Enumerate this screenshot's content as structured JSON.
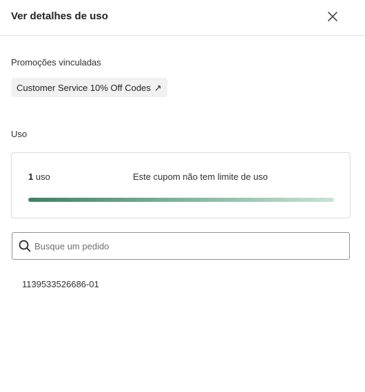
{
  "header": {
    "title": "Ver detalhes de uso",
    "close_icon": "close-icon"
  },
  "promotions": {
    "label": "Promoções vinculadas",
    "items": [
      {
        "label": "Customer Service 10% Off Codes",
        "icon": "arrow-up-right-icon"
      }
    ]
  },
  "usage": {
    "label": "Uso",
    "count_number": "1",
    "count_unit": "uso",
    "limit_text": "Este cupom não tem limite de uso",
    "progress": 1.0,
    "colors": {
      "start": "#3f8263",
      "end": "#c8e2d6"
    }
  },
  "search": {
    "placeholder": "Busque um pedido",
    "value": "",
    "icon": "search-icon"
  },
  "orders": [
    {
      "id": "1139533526686-01"
    }
  ]
}
